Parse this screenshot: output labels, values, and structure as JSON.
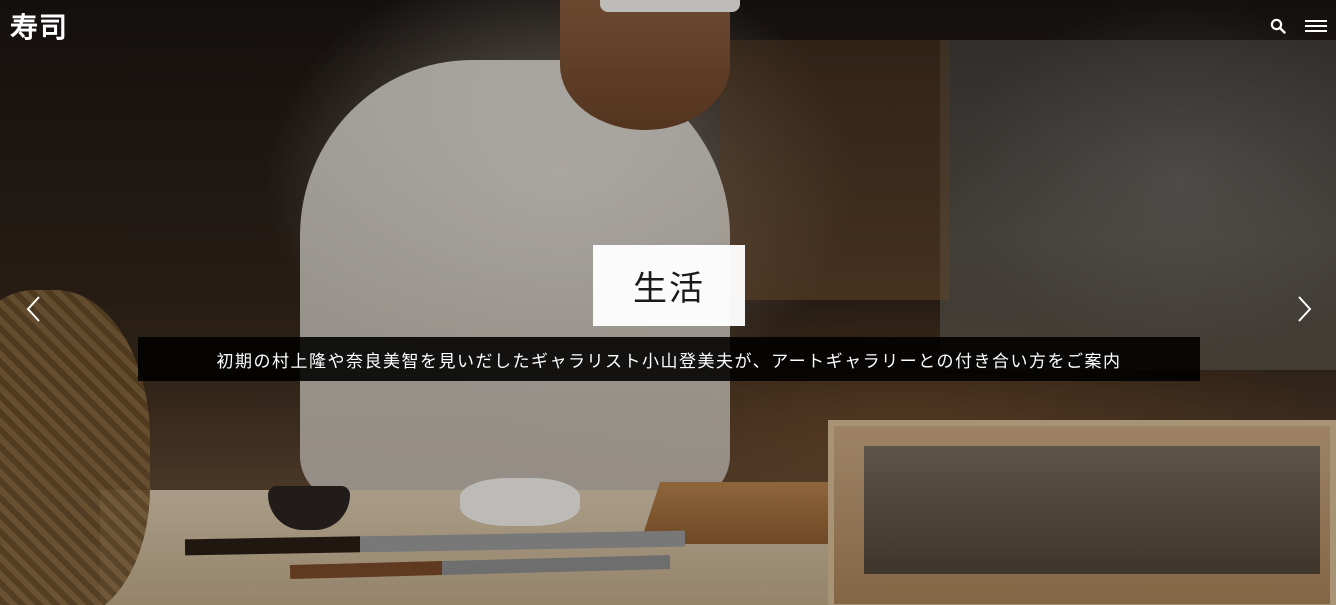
{
  "header": {
    "logo": "寿司",
    "icons": [
      "search-icon",
      "menu-icon"
    ]
  },
  "slide": {
    "category": "生活",
    "caption": "初期の村上隆や奈良美智を見いだしたギャラリスト小山登美夫が、アートギャラリーとの付き合い方をご案内",
    "controls": [
      "chevron-left-icon",
      "chevron-right-icon"
    ]
  },
  "colors": {
    "text": "#ffffff",
    "caption_bg": "#000000",
    "category_bg": "#ffffff",
    "category_text": "#1a1a1a"
  }
}
